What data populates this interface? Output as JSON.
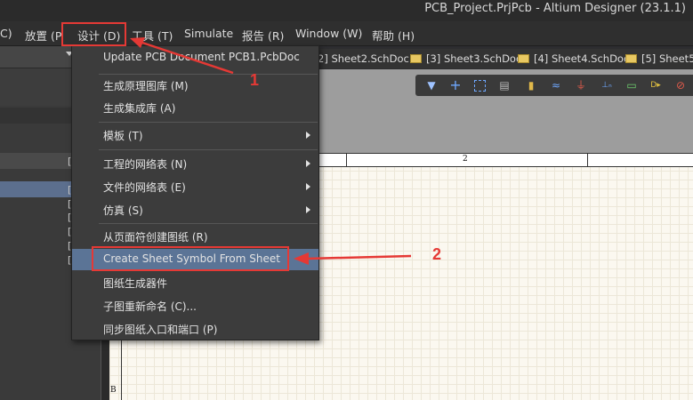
{
  "window": {
    "title": "PCB_Project.PrjPcb - Altium Designer (23.1.1)"
  },
  "menubar": {
    "items": [
      {
        "label": "C)"
      },
      {
        "label": "放置 (P"
      },
      {
        "label": "设计 (D)"
      },
      {
        "label": "工具 (T)"
      },
      {
        "label": "Simulate"
      },
      {
        "label": "报告 (R)"
      },
      {
        "label": "Window (W)"
      },
      {
        "label": "帮助 (H)"
      }
    ]
  },
  "tabs": [
    {
      "label": "2] Sheet2.SchDoc"
    },
    {
      "label": "[3] Sheet3.SchDoc"
    },
    {
      "label": "[4] Sheet4.SchDoc"
    },
    {
      "label": "[5] Sheet5.S"
    }
  ],
  "left_panel": {
    "row_marks": [
      "[",
      "[",
      "[",
      "[",
      "[",
      "[",
      "["
    ]
  },
  "dropdown": {
    "items": [
      {
        "label": "Update PCB Document PCB1.PcbDoc"
      },
      {
        "label": "生成原理图库 (M)"
      },
      {
        "label": "生成集成库 (A)"
      },
      {
        "label": "模板 (T)"
      },
      {
        "label": "工程的网络表 (N)"
      },
      {
        "label": "文件的网络表 (E)"
      },
      {
        "label": "仿真 (S)"
      },
      {
        "label": "从页面符创建图纸 (R)"
      },
      {
        "label": "Create Sheet Symbol From Sheet"
      },
      {
        "label": "图纸生成器件"
      },
      {
        "label": "子图重新命名 (C)..."
      },
      {
        "label": "同步图纸入口和端口 (P)"
      }
    ]
  },
  "sheet": {
    "column_label": "2",
    "row_label": "B"
  },
  "annotations": {
    "step1": "1",
    "step2": "2"
  },
  "colors": {
    "accent_highlight": "#5b7496",
    "annotation_red": "#e53935"
  }
}
